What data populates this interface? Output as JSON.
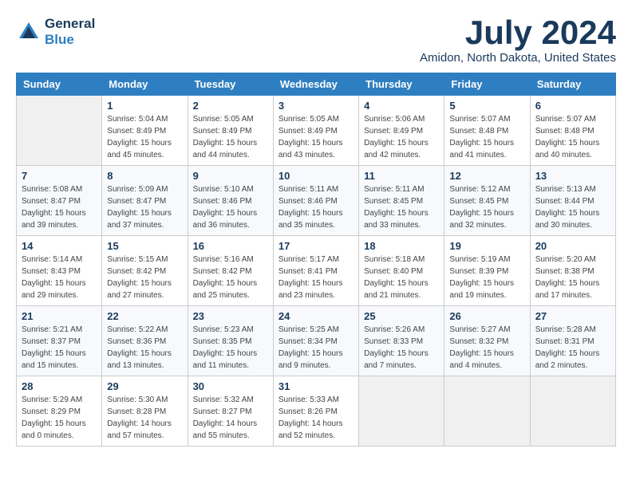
{
  "header": {
    "logo_line1": "General",
    "logo_line2": "Blue",
    "month_year": "July 2024",
    "location": "Amidon, North Dakota, United States"
  },
  "days_of_week": [
    "Sunday",
    "Monday",
    "Tuesday",
    "Wednesday",
    "Thursday",
    "Friday",
    "Saturday"
  ],
  "weeks": [
    [
      {
        "day": "",
        "info": ""
      },
      {
        "day": "1",
        "info": "Sunrise: 5:04 AM\nSunset: 8:49 PM\nDaylight: 15 hours\nand 45 minutes."
      },
      {
        "day": "2",
        "info": "Sunrise: 5:05 AM\nSunset: 8:49 PM\nDaylight: 15 hours\nand 44 minutes."
      },
      {
        "day": "3",
        "info": "Sunrise: 5:05 AM\nSunset: 8:49 PM\nDaylight: 15 hours\nand 43 minutes."
      },
      {
        "day": "4",
        "info": "Sunrise: 5:06 AM\nSunset: 8:49 PM\nDaylight: 15 hours\nand 42 minutes."
      },
      {
        "day": "5",
        "info": "Sunrise: 5:07 AM\nSunset: 8:48 PM\nDaylight: 15 hours\nand 41 minutes."
      },
      {
        "day": "6",
        "info": "Sunrise: 5:07 AM\nSunset: 8:48 PM\nDaylight: 15 hours\nand 40 minutes."
      }
    ],
    [
      {
        "day": "7",
        "info": "Sunrise: 5:08 AM\nSunset: 8:47 PM\nDaylight: 15 hours\nand 39 minutes."
      },
      {
        "day": "8",
        "info": "Sunrise: 5:09 AM\nSunset: 8:47 PM\nDaylight: 15 hours\nand 37 minutes."
      },
      {
        "day": "9",
        "info": "Sunrise: 5:10 AM\nSunset: 8:46 PM\nDaylight: 15 hours\nand 36 minutes."
      },
      {
        "day": "10",
        "info": "Sunrise: 5:11 AM\nSunset: 8:46 PM\nDaylight: 15 hours\nand 35 minutes."
      },
      {
        "day": "11",
        "info": "Sunrise: 5:11 AM\nSunset: 8:45 PM\nDaylight: 15 hours\nand 33 minutes."
      },
      {
        "day": "12",
        "info": "Sunrise: 5:12 AM\nSunset: 8:45 PM\nDaylight: 15 hours\nand 32 minutes."
      },
      {
        "day": "13",
        "info": "Sunrise: 5:13 AM\nSunset: 8:44 PM\nDaylight: 15 hours\nand 30 minutes."
      }
    ],
    [
      {
        "day": "14",
        "info": "Sunrise: 5:14 AM\nSunset: 8:43 PM\nDaylight: 15 hours\nand 29 minutes."
      },
      {
        "day": "15",
        "info": "Sunrise: 5:15 AM\nSunset: 8:42 PM\nDaylight: 15 hours\nand 27 minutes."
      },
      {
        "day": "16",
        "info": "Sunrise: 5:16 AM\nSunset: 8:42 PM\nDaylight: 15 hours\nand 25 minutes."
      },
      {
        "day": "17",
        "info": "Sunrise: 5:17 AM\nSunset: 8:41 PM\nDaylight: 15 hours\nand 23 minutes."
      },
      {
        "day": "18",
        "info": "Sunrise: 5:18 AM\nSunset: 8:40 PM\nDaylight: 15 hours\nand 21 minutes."
      },
      {
        "day": "19",
        "info": "Sunrise: 5:19 AM\nSunset: 8:39 PM\nDaylight: 15 hours\nand 19 minutes."
      },
      {
        "day": "20",
        "info": "Sunrise: 5:20 AM\nSunset: 8:38 PM\nDaylight: 15 hours\nand 17 minutes."
      }
    ],
    [
      {
        "day": "21",
        "info": "Sunrise: 5:21 AM\nSunset: 8:37 PM\nDaylight: 15 hours\nand 15 minutes."
      },
      {
        "day": "22",
        "info": "Sunrise: 5:22 AM\nSunset: 8:36 PM\nDaylight: 15 hours\nand 13 minutes."
      },
      {
        "day": "23",
        "info": "Sunrise: 5:23 AM\nSunset: 8:35 PM\nDaylight: 15 hours\nand 11 minutes."
      },
      {
        "day": "24",
        "info": "Sunrise: 5:25 AM\nSunset: 8:34 PM\nDaylight: 15 hours\nand 9 minutes."
      },
      {
        "day": "25",
        "info": "Sunrise: 5:26 AM\nSunset: 8:33 PM\nDaylight: 15 hours\nand 7 minutes."
      },
      {
        "day": "26",
        "info": "Sunrise: 5:27 AM\nSunset: 8:32 PM\nDaylight: 15 hours\nand 4 minutes."
      },
      {
        "day": "27",
        "info": "Sunrise: 5:28 AM\nSunset: 8:31 PM\nDaylight: 15 hours\nand 2 minutes."
      }
    ],
    [
      {
        "day": "28",
        "info": "Sunrise: 5:29 AM\nSunset: 8:29 PM\nDaylight: 15 hours\nand 0 minutes."
      },
      {
        "day": "29",
        "info": "Sunrise: 5:30 AM\nSunset: 8:28 PM\nDaylight: 14 hours\nand 57 minutes."
      },
      {
        "day": "30",
        "info": "Sunrise: 5:32 AM\nSunset: 8:27 PM\nDaylight: 14 hours\nand 55 minutes."
      },
      {
        "day": "31",
        "info": "Sunrise: 5:33 AM\nSunset: 8:26 PM\nDaylight: 14 hours\nand 52 minutes."
      },
      {
        "day": "",
        "info": ""
      },
      {
        "day": "",
        "info": ""
      },
      {
        "day": "",
        "info": ""
      }
    ]
  ]
}
